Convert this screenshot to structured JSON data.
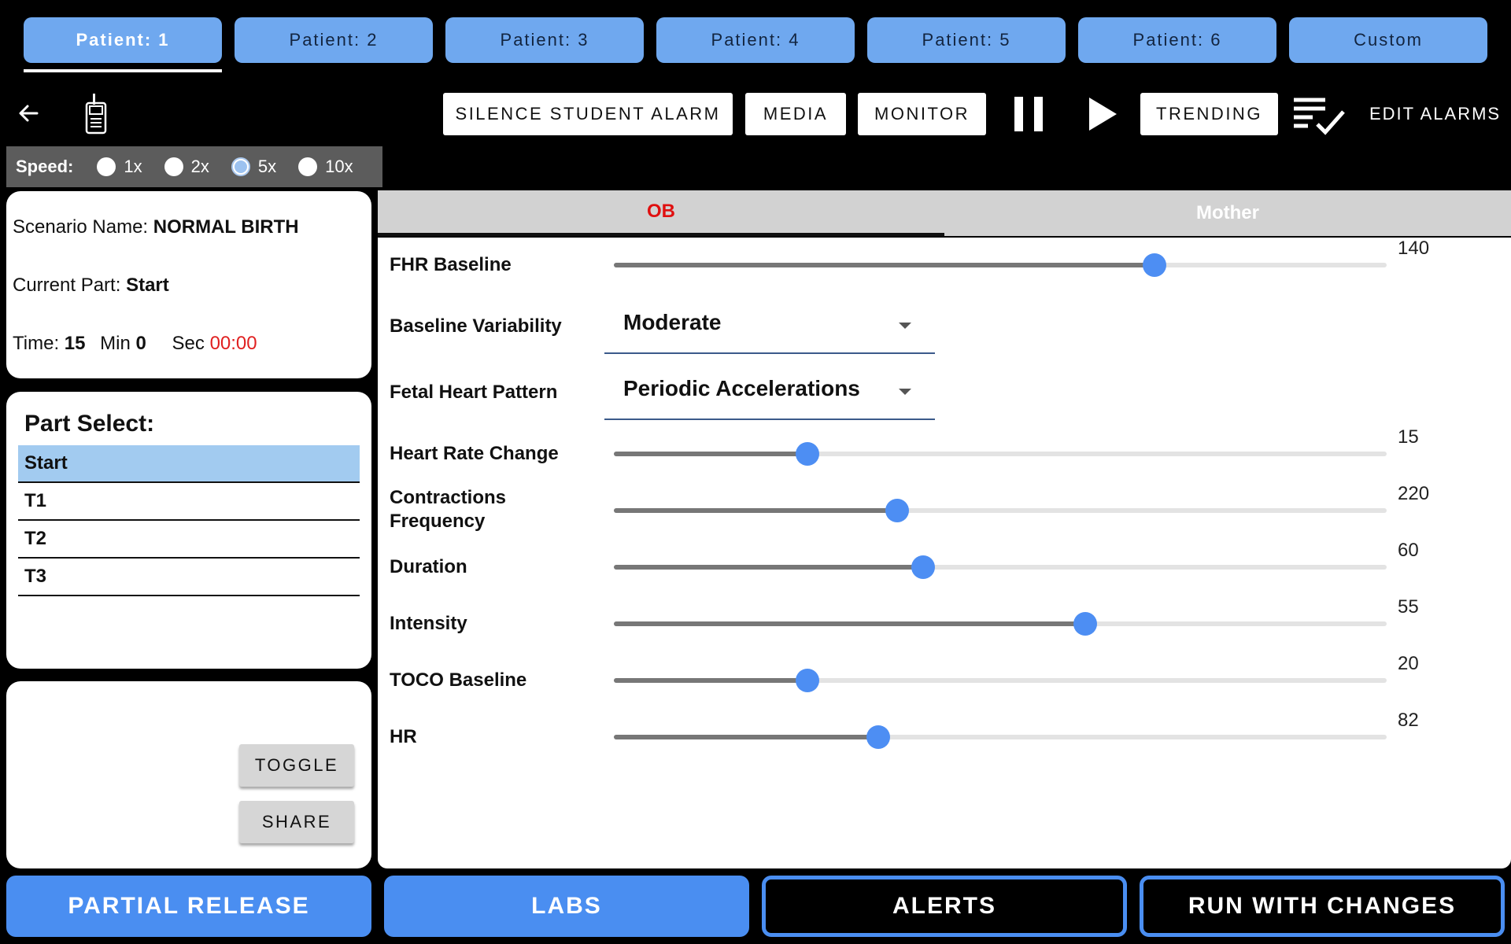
{
  "patient_tabs": [
    {
      "label": "Patient: 1"
    },
    {
      "label": "Patient: 2"
    },
    {
      "label": "Patient: 3"
    },
    {
      "label": "Patient: 4"
    },
    {
      "label": "Patient: 5"
    },
    {
      "label": "Patient: 6"
    },
    {
      "label": "Custom"
    }
  ],
  "active_patient": 0,
  "toolbar": {
    "back_icon": "arrow-left-icon",
    "device_icon": "walkie-talkie-icon",
    "silence_label": "SILENCE STUDENT ALARM",
    "media_label": "MEDIA",
    "monitor_label": "MONITOR",
    "pause_icon": "pause-icon",
    "play_icon": "play-icon",
    "trending_label": "TRENDING",
    "checklist_icon": "checklist-icon",
    "edit_alarms_label": "EDIT ALARMS"
  },
  "speed": {
    "label": "Speed:",
    "options": [
      "1x",
      "2x",
      "5x",
      "10x"
    ],
    "selected": "5x"
  },
  "scenario": {
    "name_label": "Scenario Name:",
    "name": "NORMAL BIRTH",
    "part_label": "Current Part:",
    "part": "Start",
    "time_label": "Time:",
    "min_value": "15",
    "min_label": "Min",
    "sec_value": "0",
    "sec_label": "Sec",
    "clock": "00:00"
  },
  "part_select": {
    "title": "Part Select:",
    "items": [
      "Start",
      "T1",
      "T2",
      "T3"
    ],
    "selected": "Start"
  },
  "side_actions": {
    "toggle_label": "TOGGLE",
    "share_label": "SHARE"
  },
  "panel_tabs": {
    "ob_label": "OB",
    "mother_label": "Mother",
    "active": "OB"
  },
  "params": {
    "fhr_baseline": {
      "label": "FHR Baseline",
      "value": "140",
      "fraction": 0.7
    },
    "baseline_variability": {
      "label": "Baseline Variability",
      "value": "Moderate"
    },
    "fetal_heart_pattern": {
      "label": "Fetal Heart Pattern",
      "value": "Periodic Accelerations"
    },
    "heart_rate_change": {
      "label": "Heart Rate Change",
      "value": "15",
      "fraction": 0.25
    },
    "contractions_frequency": {
      "label": "Contractions Frequency",
      "value": "220",
      "fraction": 0.367
    },
    "duration": {
      "label": "Duration",
      "value": "60",
      "fraction": 0.4
    },
    "intensity": {
      "label": "Intensity",
      "value": "55",
      "fraction": 0.61
    },
    "toco_baseline": {
      "label": "TOCO Baseline",
      "value": "20",
      "fraction": 0.25
    },
    "hr": {
      "label": "HR",
      "value": "82",
      "fraction": 0.342
    }
  },
  "bottom": {
    "partial_release_label": "PARTIAL RELEASE",
    "labs_label": "LABS",
    "alerts_label": "ALERTS",
    "run_label": "RUN WITH CHANGES"
  },
  "colors": {
    "accent_blue": "#4a8ef1",
    "tab_blue": "#6fa8ef",
    "selected_row": "#a2cbf0",
    "time_red": "#e02020",
    "ob_red": "#e01010"
  }
}
